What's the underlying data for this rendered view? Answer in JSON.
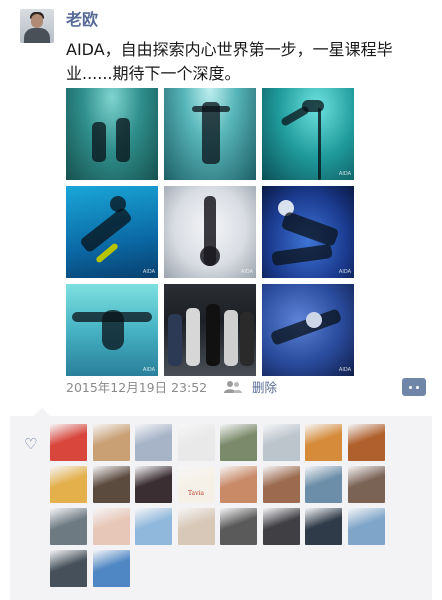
{
  "post": {
    "author": "老欧",
    "text": "AIDA，自由探索内心世界第一步，一星课程毕业......期待下一个深度。",
    "timestamp": "2015年12月19日 23:52",
    "delete_label": "删除",
    "photo_watermark": "AIDA"
  },
  "icons": {
    "avatar": "author-avatar",
    "people": "people-icon",
    "comment": "comment-icon",
    "like": "heart-icon"
  },
  "likes": {
    "avatar_badge": "Tavia",
    "colors": [
      "#d8463c",
      "#c9a074",
      "#a7b4c8",
      "#e9e9e9",
      "#7b8a6a",
      "#bcc4cc",
      "#d58b3a",
      "#b0602c",
      "#e3b04b",
      "#5b4a3e",
      "#3b2e33",
      "#f6f1e8",
      "#c98a68",
      "#9c6b4f",
      "#6c8ea8",
      "#7a6255",
      "#6e7a82",
      "#e7c7b8",
      "#8fb8dc",
      "#d8c8b8",
      "#5a5a5a",
      "#3f3f44",
      "#2f3b48",
      "#7fa6c9",
      "#45505a",
      "#4f87c4"
    ]
  },
  "colors": {
    "link": "#576b95",
    "meta": "#8a8a8a",
    "panel": "#f3f3f5"
  }
}
